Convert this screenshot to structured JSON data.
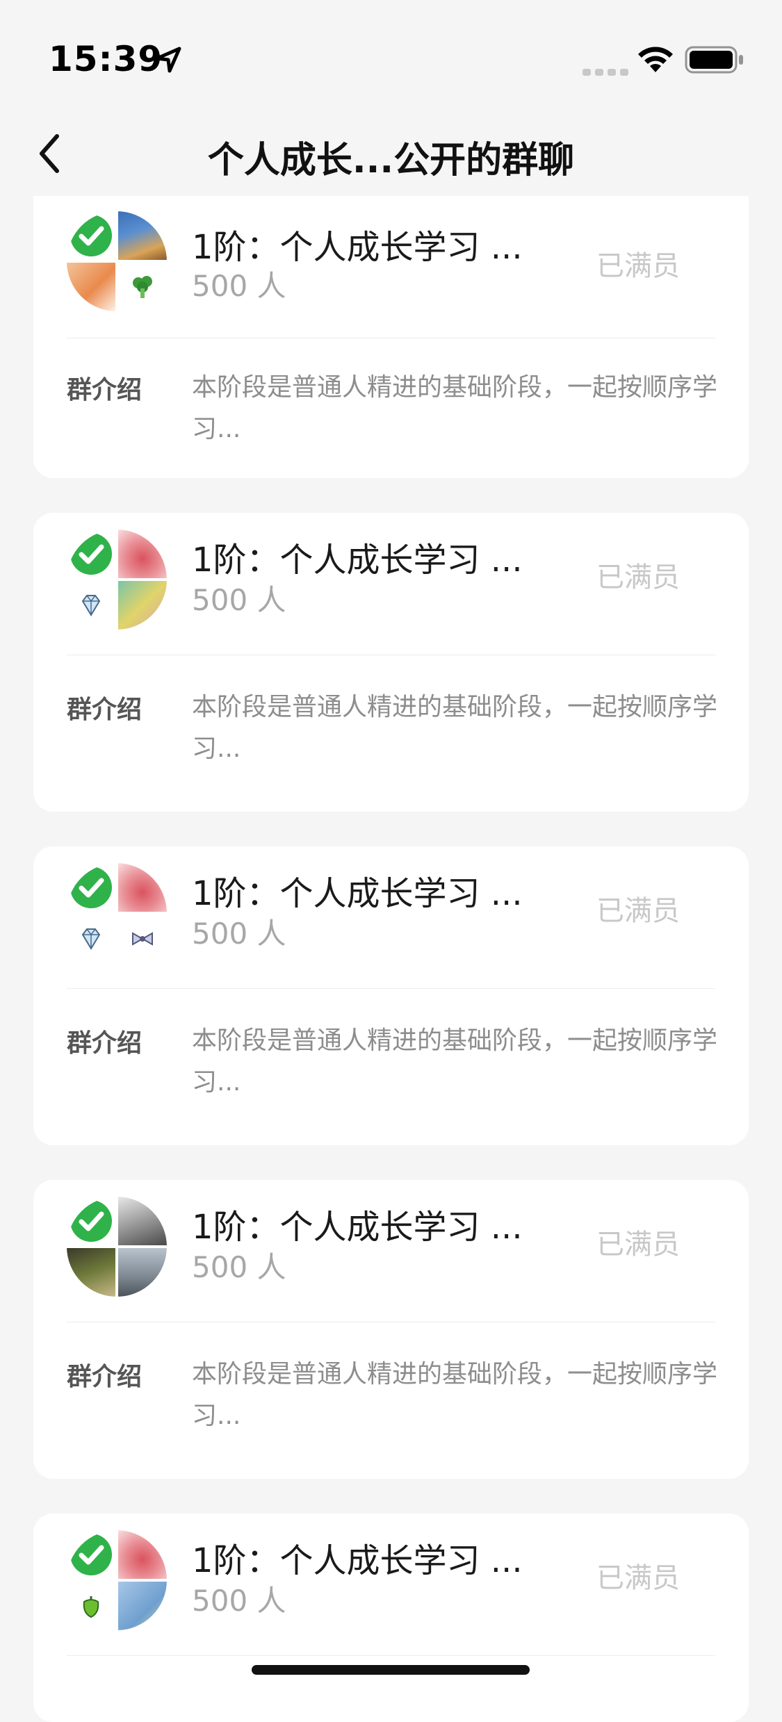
{
  "status_bar": {
    "time": "15:39"
  },
  "nav": {
    "title": "个人成长...公开的群聊"
  },
  "groups": [
    {
      "title": "1阶：个人成长学习 ...",
      "members": "500 人",
      "status": "已满员",
      "intro_label": "群介绍",
      "intro": "本阶段是普通人精进的基础阶段，一起按顺序学习..."
    },
    {
      "title": "1阶：个人成长学习 ...",
      "members": "500 人",
      "status": "已满员",
      "intro_label": "群介绍",
      "intro": "本阶段是普通人精进的基础阶段，一起按顺序学习..."
    },
    {
      "title": "1阶：个人成长学习 ...",
      "members": "500 人",
      "status": "已满员",
      "intro_label": "群介绍",
      "intro": "本阶段是普通人精进的基础阶段，一起按顺序学习..."
    },
    {
      "title": "1阶：个人成长学习 ...",
      "members": "500 人",
      "status": "已满员",
      "intro_label": "群介绍",
      "intro": "本阶段是普通人精进的基础阶段，一起按顺序学习..."
    },
    {
      "title": "1阶：个人成长学习 ...",
      "members": "500 人",
      "status": "已满员"
    }
  ],
  "colors": {
    "check_green": "#2fb24a",
    "bg": "#f5f5f5",
    "card": "#ffffff"
  }
}
